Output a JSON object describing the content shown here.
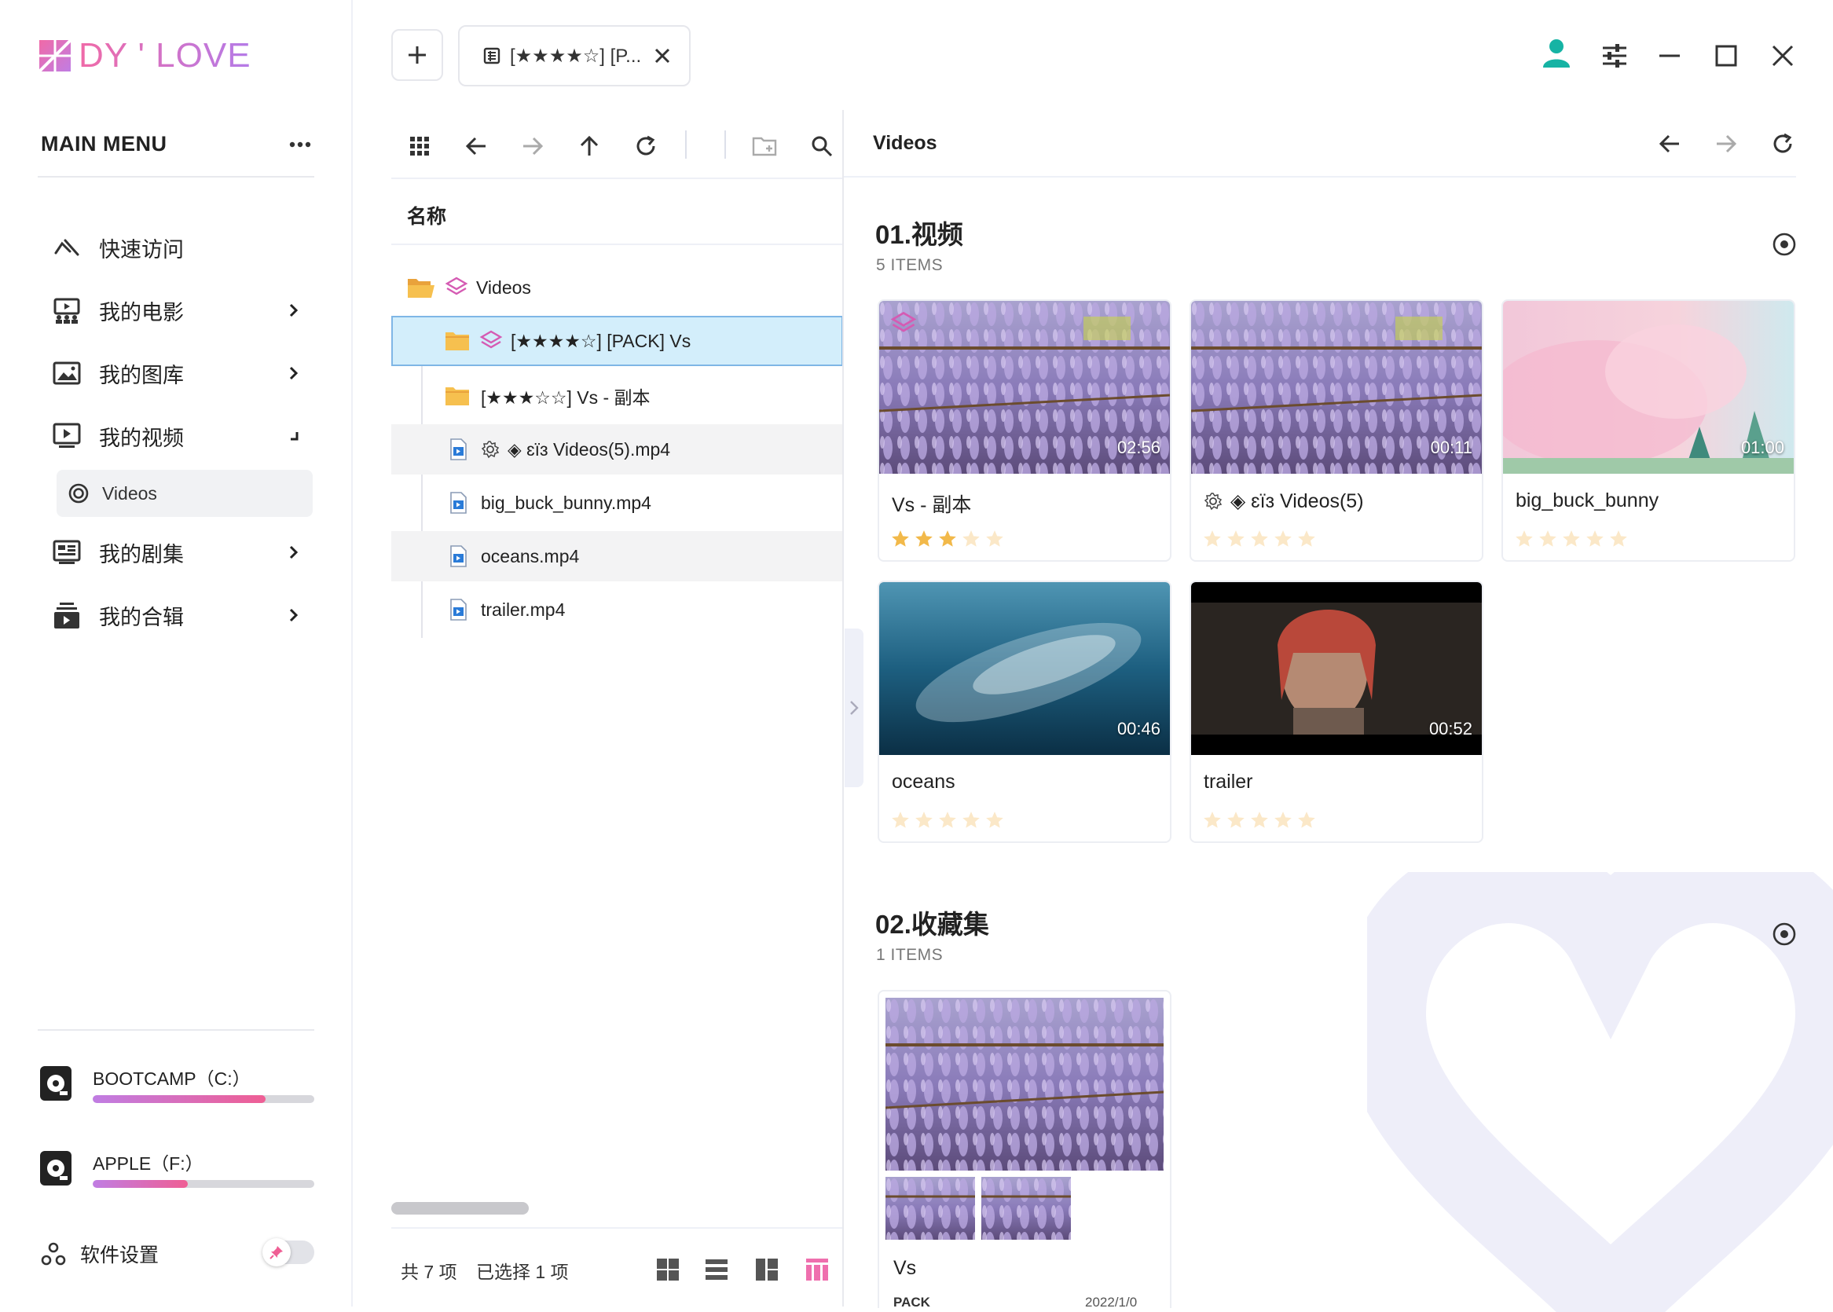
{
  "app": {
    "logo_text": "DY ' LOVE",
    "brand_pink": "#ef5e94",
    "brand_purple": "#b47be8"
  },
  "sidebar": {
    "menu_title": "MAIN MENU",
    "items": [
      {
        "label": "快速访问",
        "icon": "quick-access-icon",
        "arrow": false
      },
      {
        "label": "我的电影",
        "icon": "movie-icon",
        "arrow": true
      },
      {
        "label": "我的图库",
        "icon": "image-icon",
        "arrow": true
      },
      {
        "label": "我的视频",
        "icon": "video-icon",
        "arrow": true
      },
      {
        "label": "我的剧集",
        "icon": "series-icon",
        "arrow": true
      },
      {
        "label": "我的合辑",
        "icon": "collection-icon",
        "arrow": true
      }
    ],
    "sub_item": {
      "label": "Videos"
    },
    "drives": [
      {
        "label": "BOOTCAMP（C:）",
        "used": 0.78
      },
      {
        "label": "APPLE（F:）",
        "used": 0.43
      }
    ],
    "settings_label": "软件设置"
  },
  "tabs": [
    {
      "label": "[★★★★☆] [P..."
    }
  ],
  "tree": {
    "column_header": "名称",
    "rows": [
      {
        "label": "Videos",
        "type": "root-folder"
      },
      {
        "label": "[★★★★☆] [PACK] Vs",
        "type": "pack-folder",
        "selected": true
      },
      {
        "label": "[★★★☆☆] Vs - 副本",
        "type": "folder"
      },
      {
        "label": "◈ ɛïɜ Videos(5).mp4",
        "type": "video-gear",
        "alt": true
      },
      {
        "label": "big_buck_bunny.mp4",
        "type": "video"
      },
      {
        "label": "oceans.mp4",
        "type": "video",
        "alt": true
      },
      {
        "label": "trailer.mp4",
        "type": "video"
      }
    ],
    "status_total": "共 7 项",
    "status_selected": "已选择 1 项"
  },
  "content": {
    "pane_title": "Videos",
    "sections": [
      {
        "title": "01.视频",
        "count": "5 ITEMS",
        "cards": [
          {
            "title": "Vs - 副本",
            "duration": "02:56",
            "rating": 3,
            "thumb": "wisteria"
          },
          {
            "title": "◈ ɛïɜ Videos(5)",
            "duration": "00:11",
            "rating": 0,
            "thumb": "wisteria"
          },
          {
            "title": "big_buck_bunny",
            "duration": "01:00",
            "rating": 0,
            "thumb": "sky"
          },
          {
            "title": "oceans",
            "duration": "00:46",
            "rating": 0,
            "thumb": "ocean"
          },
          {
            "title": "trailer",
            "duration": "00:52",
            "rating": 0,
            "thumb": "dark"
          }
        ]
      },
      {
        "title": "02.收藏集",
        "count": "1 ITEMS",
        "collection": {
          "title": "Vs",
          "tag": "PACK",
          "date": "2022/1/0"
        }
      }
    ]
  }
}
